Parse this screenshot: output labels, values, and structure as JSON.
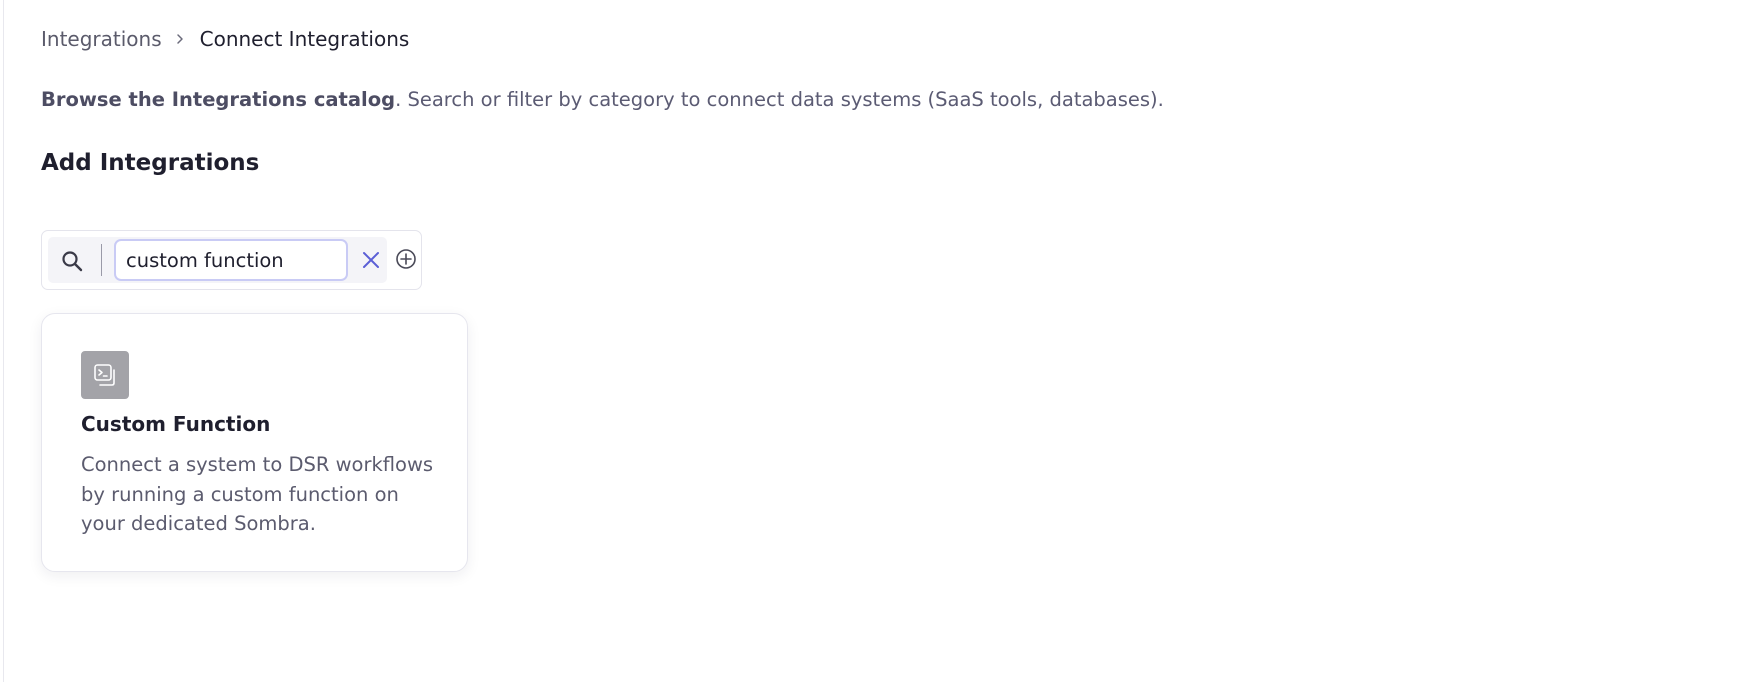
{
  "breadcrumb": {
    "parent": "Integrations",
    "current": "Connect Integrations"
  },
  "intro": {
    "link_text": "Browse the Integrations catalog",
    "rest_text": ". Search or filter by category to connect data systems (SaaS tools, databases)."
  },
  "section": {
    "title": "Add Integrations"
  },
  "search": {
    "value": "custom function",
    "icons": {
      "search": "search-icon",
      "clear": "close-icon",
      "add": "plus-circle-icon"
    },
    "colors": {
      "clear": "#5b5fd6",
      "focus_border": "#c9cbf5"
    }
  },
  "results": [
    {
      "icon": "terminal-icon",
      "title": "Custom Function",
      "description": "Connect a system to DSR workflows by running a custom function on your dedicated Sombra."
    }
  ]
}
